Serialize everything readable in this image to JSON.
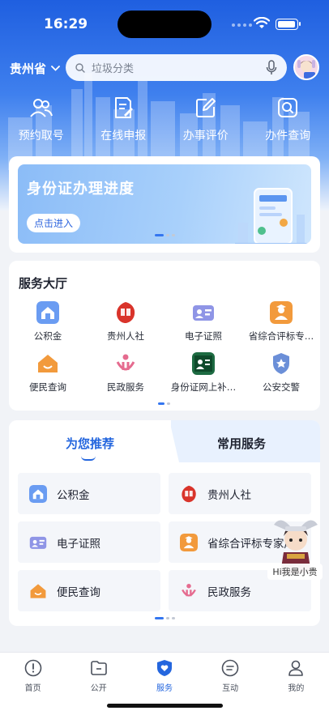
{
  "status_bar": {
    "time": "16:29"
  },
  "header": {
    "region": "贵州省",
    "search_placeholder": "垃圾分类"
  },
  "quick_actions": [
    {
      "label": "预约取号",
      "icon": "people-icon"
    },
    {
      "label": "在线申报",
      "icon": "document-edit-icon"
    },
    {
      "label": "办事评价",
      "icon": "pencil-square-icon"
    },
    {
      "label": "办件查询",
      "icon": "search-square-icon"
    }
  ],
  "banner": {
    "title": "身份证办理进度",
    "button": "点击进入"
  },
  "service_hall": {
    "title": "服务大厅",
    "items": [
      {
        "label": "公积金",
        "icon": "housing-fund-icon",
        "color": "#5a8dee"
      },
      {
        "label": "贵州人社",
        "icon": "guizhou-social-security-icon",
        "color": "#d9342b"
      },
      {
        "label": "电子证照",
        "icon": "id-card-icon",
        "color": "#8f95e6"
      },
      {
        "label": "省综合评标专…",
        "icon": "expert-icon",
        "color": "#f29a3c"
      },
      {
        "label": "便民查询",
        "icon": "house-smile-icon",
        "color": "#f29a3c"
      },
      {
        "label": "民政服务",
        "icon": "civil-affairs-icon",
        "color": "#e56b8f"
      },
      {
        "label": "身份证网上补…",
        "icon": "id-reissue-icon",
        "color": "#1d7a4a"
      },
      {
        "label": "公安交警",
        "icon": "police-badge-icon",
        "color": "#6b8fd8"
      }
    ]
  },
  "recommend": {
    "tab_active": "为您推荐",
    "tab_inactive": "常用服务",
    "items": [
      {
        "label": "公积金",
        "icon": "housing-fund-icon",
        "color": "#5a8dee"
      },
      {
        "label": "贵州人社",
        "icon": "guizhou-social-security-icon",
        "color": "#d9342b"
      },
      {
        "label": "电子证照",
        "icon": "id-card-icon",
        "color": "#8f95e6"
      },
      {
        "label": "省综合评标专家库",
        "icon": "expert-icon",
        "color": "#f29a3c"
      },
      {
        "label": "便民查询",
        "icon": "house-smile-icon",
        "color": "#f29a3c"
      },
      {
        "label": "民政服务",
        "icon": "civil-affairs-icon",
        "color": "#e56b8f"
      }
    ]
  },
  "mascot": {
    "label": "Hi我是小贵"
  },
  "tabbar": {
    "items": [
      {
        "label": "首页",
        "icon": "home-alert-icon"
      },
      {
        "label": "公开",
        "icon": "folder-icon"
      },
      {
        "label": "服务",
        "icon": "shield-heart-icon",
        "active": true
      },
      {
        "label": "互动",
        "icon": "chat-icon"
      },
      {
        "label": "我的",
        "icon": "user-icon"
      }
    ]
  },
  "colors": {
    "primary": "#2466de",
    "hero": "#1f5fe0"
  }
}
